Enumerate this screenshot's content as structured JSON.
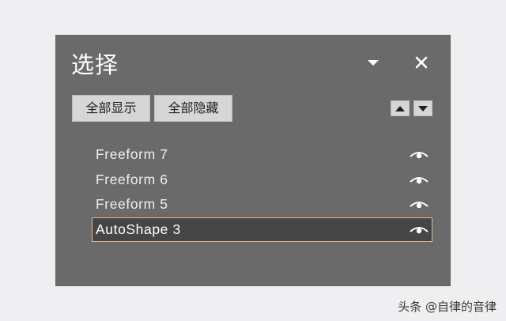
{
  "pane": {
    "title": "选择",
    "menu_icon": "dropdown-triangle-icon",
    "close_icon": "close-icon",
    "show_all_label": "全部显示",
    "hide_all_label": "全部隐藏",
    "bring_forward_icon": "triangle-up-icon",
    "send_backward_icon": "triangle-down-icon"
  },
  "objects": [
    {
      "label": "Freeform 7",
      "visible": true,
      "selected": false
    },
    {
      "label": "Freeform 6",
      "visible": true,
      "selected": false
    },
    {
      "label": "Freeform 5",
      "visible": true,
      "selected": false
    },
    {
      "label": "AutoShape 3",
      "visible": true,
      "selected": true
    }
  ],
  "colors": {
    "pane_background": "#6a6a6a",
    "selection_border": "#e7b48f",
    "page_background": "#efeef0"
  },
  "watermark": "头条 @自律的音律"
}
